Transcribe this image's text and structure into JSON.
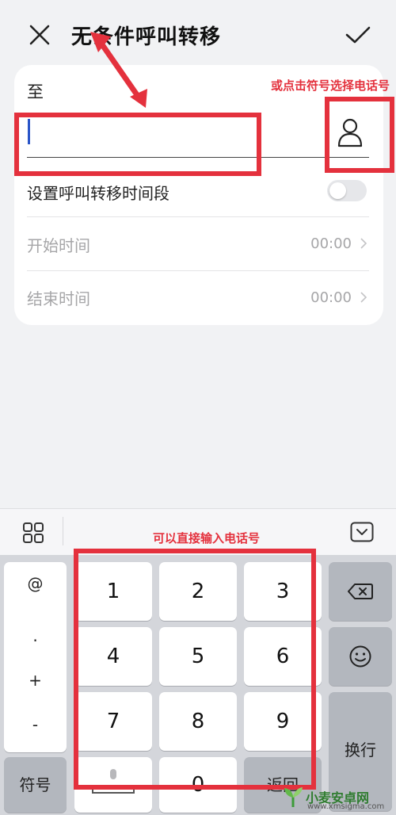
{
  "header": {
    "title": "无条件呼叫转移",
    "close_icon": "close-icon",
    "confirm_icon": "check-icon"
  },
  "form": {
    "to_label": "至",
    "number_value": "",
    "contact_icon": "person-icon",
    "schedule_label": "设置呼叫转移时间段",
    "schedule_enabled": false,
    "start_label": "开始时间",
    "start_value": "00:00",
    "end_label": "结束时间",
    "end_value": "00:00"
  },
  "annotations": {
    "contact_hint": "或点击符号选择电话号",
    "keyboard_hint": "可以直接输入电话号"
  },
  "keyboard": {
    "symbols": [
      "@",
      ".",
      "+",
      "-"
    ],
    "digits": [
      "1",
      "2",
      "3",
      "4",
      "5",
      "6",
      "7",
      "8",
      "9"
    ],
    "symbols_key": "符号",
    "zero_key": "0",
    "return_key": "返回",
    "enter_key": "换行",
    "backspace_icon": "backspace-icon",
    "emoji_icon": "emoji-icon",
    "grid_icon": "grid-icon",
    "hide_icon": "hide-keyboard-icon",
    "mic_icon": "mic-icon"
  },
  "colors": {
    "annotation": "#e4313d",
    "caret": "#2a55c8"
  }
}
